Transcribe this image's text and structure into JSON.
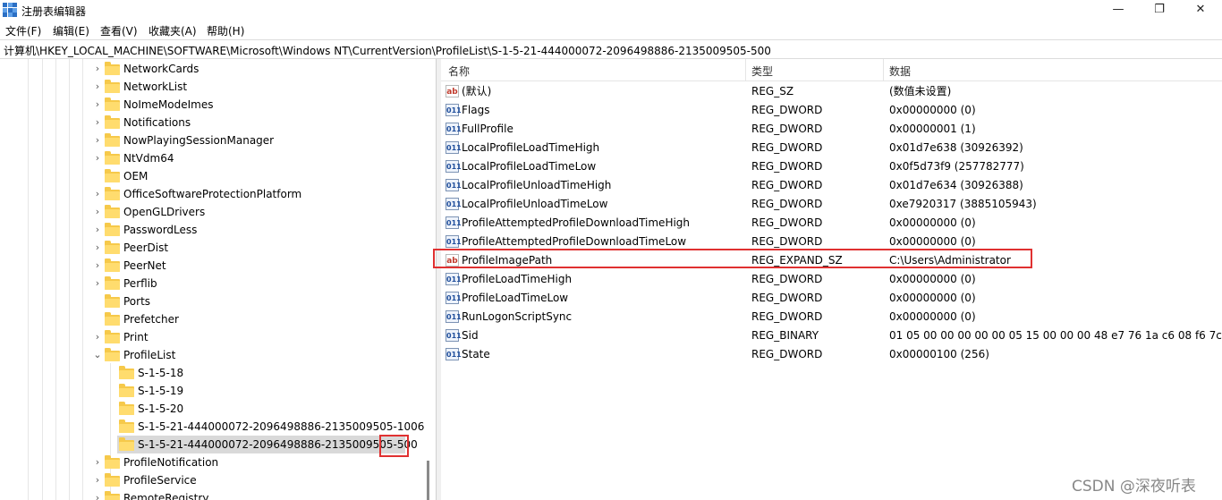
{
  "window": {
    "title": "注册表编辑器",
    "minimize_glyph": "—",
    "maximize_glyph": "❐",
    "close_glyph": "✕"
  },
  "menu": [
    "文件(F)",
    "编辑(E)",
    "查看(V)",
    "收藏夹(A)",
    "帮助(H)"
  ],
  "address": "计算机\\HKEY_LOCAL_MACHINE\\SOFTWARE\\Microsoft\\Windows NT\\CurrentVersion\\ProfileList\\S-1-5-21-444000072-2096498886-2135009505-500",
  "tree": {
    "items": [
      "NetworkCards",
      "NetworkList",
      "NoImeModeImes",
      "Notifications",
      "NowPlayingSessionManager",
      "NtVdm64",
      "OEM",
      "OfficeSoftwareProtectionPlatform",
      "OpenGLDrivers",
      "PasswordLess",
      "PeerDist",
      "PeerNet",
      "Perflib",
      "Ports",
      "Prefetcher",
      "Print",
      "ProfileList",
      "S-1-5-18",
      "S-1-5-19",
      "S-1-5-20",
      "S-1-5-21-444000072-2096498886-2135009505-1006",
      "S-1-5-21-444000072-2096498886-2135009505-500",
      "ProfileNotification",
      "ProfileService",
      "RemoteRegistry"
    ],
    "chevron_collapsed": "›",
    "chevron_expanded": "⌄"
  },
  "list": {
    "columns": [
      "名称",
      "类型",
      "数据"
    ],
    "rows": [
      {
        "name": "(默认)",
        "type": "REG_SZ",
        "data": "(数值未设置)",
        "icon": "string-value-icon"
      },
      {
        "name": "Flags",
        "type": "REG_DWORD",
        "data": "0x00000000 (0)",
        "icon": "binary-value-icon"
      },
      {
        "name": "FullProfile",
        "type": "REG_DWORD",
        "data": "0x00000001 (1)",
        "icon": "binary-value-icon"
      },
      {
        "name": "LocalProfileLoadTimeHigh",
        "type": "REG_DWORD",
        "data": "0x01d7e638 (30926392)",
        "icon": "binary-value-icon"
      },
      {
        "name": "LocalProfileLoadTimeLow",
        "type": "REG_DWORD",
        "data": "0x0f5d73f9 (257782777)",
        "icon": "binary-value-icon"
      },
      {
        "name": "LocalProfileUnloadTimeHigh",
        "type": "REG_DWORD",
        "data": "0x01d7e634 (30926388)",
        "icon": "binary-value-icon"
      },
      {
        "name": "LocalProfileUnloadTimeLow",
        "type": "REG_DWORD",
        "data": "0xe7920317 (3885105943)",
        "icon": "binary-value-icon"
      },
      {
        "name": "ProfileAttemptedProfileDownloadTimeHigh",
        "type": "REG_DWORD",
        "data": "0x00000000 (0)",
        "icon": "binary-value-icon"
      },
      {
        "name": "ProfileAttemptedProfileDownloadTimeLow",
        "type": "REG_DWORD",
        "data": "0x00000000 (0)",
        "icon": "binary-value-icon"
      },
      {
        "name": "ProfileImagePath",
        "type": "REG_EXPAND_SZ",
        "data": "C:\\Users\\Administrator",
        "icon": "string-value-icon"
      },
      {
        "name": "ProfileLoadTimeHigh",
        "type": "REG_DWORD",
        "data": "0x00000000 (0)",
        "icon": "binary-value-icon"
      },
      {
        "name": "ProfileLoadTimeLow",
        "type": "REG_DWORD",
        "data": "0x00000000 (0)",
        "icon": "binary-value-icon"
      },
      {
        "name": "RunLogonScriptSync",
        "type": "REG_DWORD",
        "data": "0x00000000 (0)",
        "icon": "binary-value-icon"
      },
      {
        "name": "Sid",
        "type": "REG_BINARY",
        "data": "01 05 00 00 00 00 00 05 15 00 00 00 48 e7 76 1a c6 08 f6 7c e1",
        "icon": "binary-value-icon"
      },
      {
        "name": "State",
        "type": "REG_DWORD",
        "data": "0x00000100 (256)",
        "icon": "binary-value-icon"
      }
    ],
    "string_icon_text": "ab",
    "binary_icon_text": "011"
  },
  "watermark": "CSDN @深夜听表",
  "colors": {
    "highlight": "#e03131",
    "folder": "#f6c94a",
    "selection": "#d9d9d9"
  }
}
